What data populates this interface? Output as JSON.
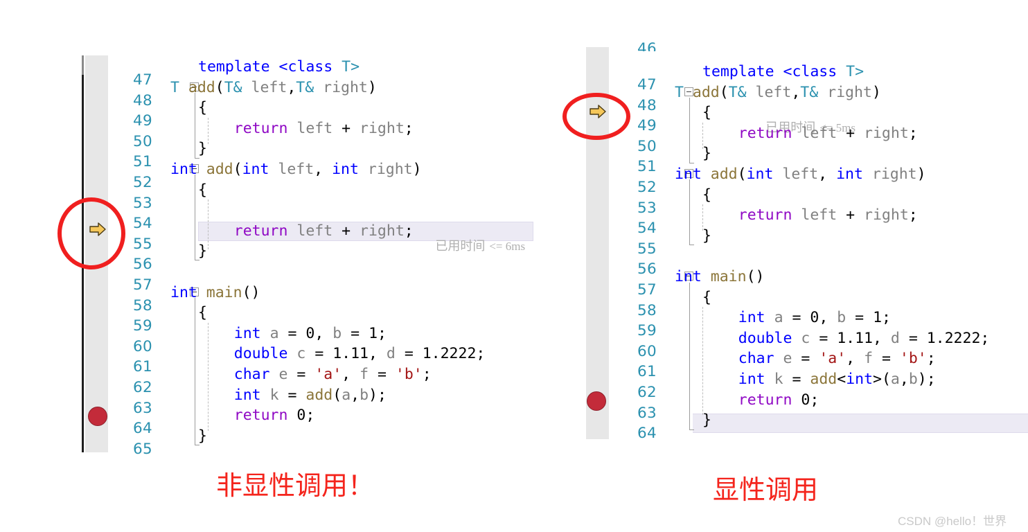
{
  "colors": {
    "line_number": "#2b91af",
    "keyword": "#0000ff",
    "control_keyword": "#8f08c4",
    "function": "#8b7539",
    "identifier": "#808080",
    "string": "#a31515",
    "type": "#2b91af",
    "caption_red": "#f4241c",
    "circle_red": "#f01f1f",
    "breakpoint_red": "#c32b3a",
    "arrow_yellow": "#f5c75a",
    "gutter_gray": "#e7e7e7",
    "highlight_band": "#eceaf4",
    "watermark_gray": "#c9c9c9"
  },
  "left_panel": {
    "name": "non-explicit-call-editor",
    "gutter_icons": {
      "current_statement_arrow": "arrow-right-icon",
      "breakpoint": "breakpoint-dot-icon",
      "breakpoint_line": "64",
      "current_statement_line": "55"
    },
    "lines": [
      {
        "n": "47",
        "code": "template <class T>"
      },
      {
        "n": "48",
        "code": "T add(T& left,T& right)"
      },
      {
        "n": "49",
        "code": "{"
      },
      {
        "n": "50",
        "code": "    return left + right;"
      },
      {
        "n": "51",
        "code": "}"
      },
      {
        "n": "52",
        "code": "int add(int left, int right)"
      },
      {
        "n": "53",
        "code": "{"
      },
      {
        "n": "54",
        "code": ""
      },
      {
        "n": "55",
        "code": "    return left + right;"
      },
      {
        "n": "56",
        "code": "}"
      },
      {
        "n": "57",
        "code": ""
      },
      {
        "n": "58",
        "code": "int main()"
      },
      {
        "n": "59",
        "code": "{"
      },
      {
        "n": "60",
        "code": "    int a = 0, b = 1;"
      },
      {
        "n": "61",
        "code": "    double c = 1.11, d = 1.2222;"
      },
      {
        "n": "62",
        "code": "    char e = 'a', f = 'b';"
      },
      {
        "n": "63",
        "code": "    int k = add(a,b);"
      },
      {
        "n": "64",
        "code": "    return 0;"
      },
      {
        "n": "65",
        "code": "}"
      }
    ],
    "elapsed_annotation": {
      "label": "已用时间",
      "value": "<= 6ms",
      "on_line": "55"
    },
    "caption": "非显性调用！"
  },
  "right_panel": {
    "name": "explicit-call-editor",
    "gutter_icons": {
      "current_statement_arrow": "arrow-right-icon",
      "breakpoint": "breakpoint-dot-icon",
      "breakpoint_line": "63",
      "current_statement_line": "49"
    },
    "partial_top_line": "46",
    "lines": [
      {
        "n": "47",
        "code": "template <class T>"
      },
      {
        "n": "48",
        "code": "T add(T& left,T& right)"
      },
      {
        "n": "49",
        "code": "{"
      },
      {
        "n": "50",
        "code": "    return left + right;"
      },
      {
        "n": "51",
        "code": "}"
      },
      {
        "n": "52",
        "code": "int add(int left, int right)"
      },
      {
        "n": "53",
        "code": "{"
      },
      {
        "n": "54",
        "code": "    return left + right;"
      },
      {
        "n": "55",
        "code": "}"
      },
      {
        "n": "56",
        "code": ""
      },
      {
        "n": "57",
        "code": "int main()"
      },
      {
        "n": "58",
        "code": "{"
      },
      {
        "n": "59",
        "code": "    int a = 0, b = 1;"
      },
      {
        "n": "60",
        "code": "    double c = 1.11, d = 1.2222;"
      },
      {
        "n": "61",
        "code": "    char e = 'a', f = 'b';"
      },
      {
        "n": "62",
        "code": "    int k = add<int>(a,b);"
      },
      {
        "n": "63",
        "code": "    return 0;"
      },
      {
        "n": "64",
        "code": "}"
      }
    ],
    "elapsed_annotation": {
      "label": "已用时间",
      "value": "<= 5ms",
      "on_line": "49"
    },
    "caption": "显性调用"
  },
  "watermark": "CSDN @hello！世界"
}
